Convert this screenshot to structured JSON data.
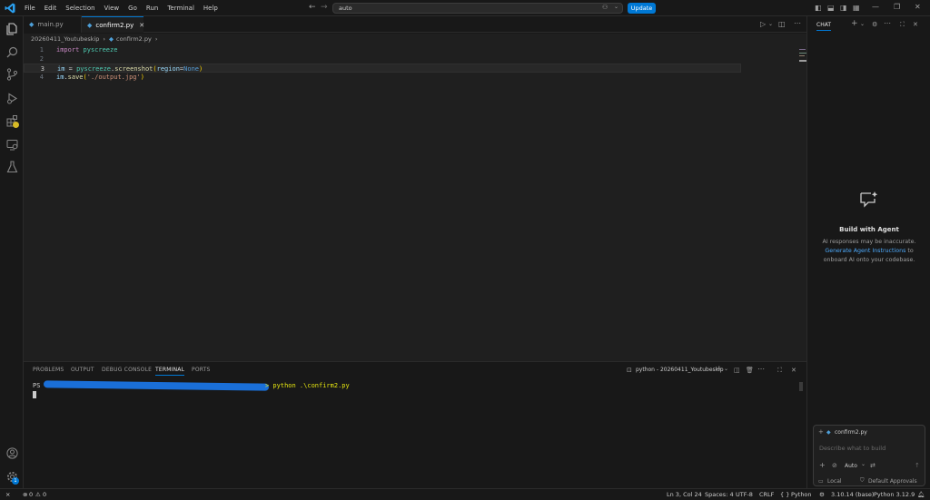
{
  "menu": [
    "File",
    "Edit",
    "Selection",
    "View",
    "Go",
    "Run",
    "Terminal",
    "Help"
  ],
  "command_center": {
    "value": "auto"
  },
  "update_label": "Update",
  "tabs": [
    {
      "label": "main.py"
    },
    {
      "label": "confirm2.py"
    }
  ],
  "breadcrumb": {
    "folder": "20260411_Youtubeskip",
    "file": "confirm2.py"
  },
  "code": {
    "numbers": [
      "1",
      "2",
      "3",
      "4"
    ],
    "l1": {
      "kw": "import",
      "mod": " pyscreeze"
    },
    "l3": {
      "var": "im",
      "eq": " = ",
      "mod": "pyscreeze",
      "dot": ".",
      "fn": "screenshot",
      "p1": "(",
      "arg": "region",
      "assign": "=",
      "val": "None",
      "p2": ")"
    },
    "l4": {
      "var": "im",
      "dot": ".",
      "fn": "save",
      "p1": "(",
      "str": "'./output.jpg'",
      "p2": ")"
    }
  },
  "panel": {
    "tabs": [
      "PROBLEMS",
      "OUTPUT",
      "DEBUG CONSOLE",
      "TERMINAL",
      "PORTS"
    ],
    "terminal_name": "python - 20260411_Youtubeskip",
    "prompt": "PS",
    "command": "> python .\\confirm2.py"
  },
  "chat": {
    "title": "CHAT",
    "heading": "Build with Agent",
    "desc1": "AI responses may be inaccurate.",
    "link": "Generate Agent Instructions",
    "desc2": " to",
    "desc3": "onboard AI onto your codebase.",
    "context_file": "confirm2.py",
    "placeholder": "Describe what to build",
    "mode": "Auto",
    "location": "Local",
    "approvals": "Default Approvals"
  },
  "status": {
    "errors": "0",
    "warnings": "0",
    "position": "Ln 3, Col 24",
    "spaces": "Spaces: 4",
    "encoding": "UTF-8",
    "eol": "CRLF",
    "braces": "{ }",
    "language": "Python",
    "interpreter": "3.10.14 (base)",
    "python": "Python 3.12.9"
  },
  "colors": {
    "accent": "#0078d4",
    "keyword": "#c586c0",
    "module": "#4ec9b0",
    "function": "#dcdcaa",
    "variable": "#9cdcfe",
    "string": "#ce9178",
    "constant": "#569cd6"
  }
}
